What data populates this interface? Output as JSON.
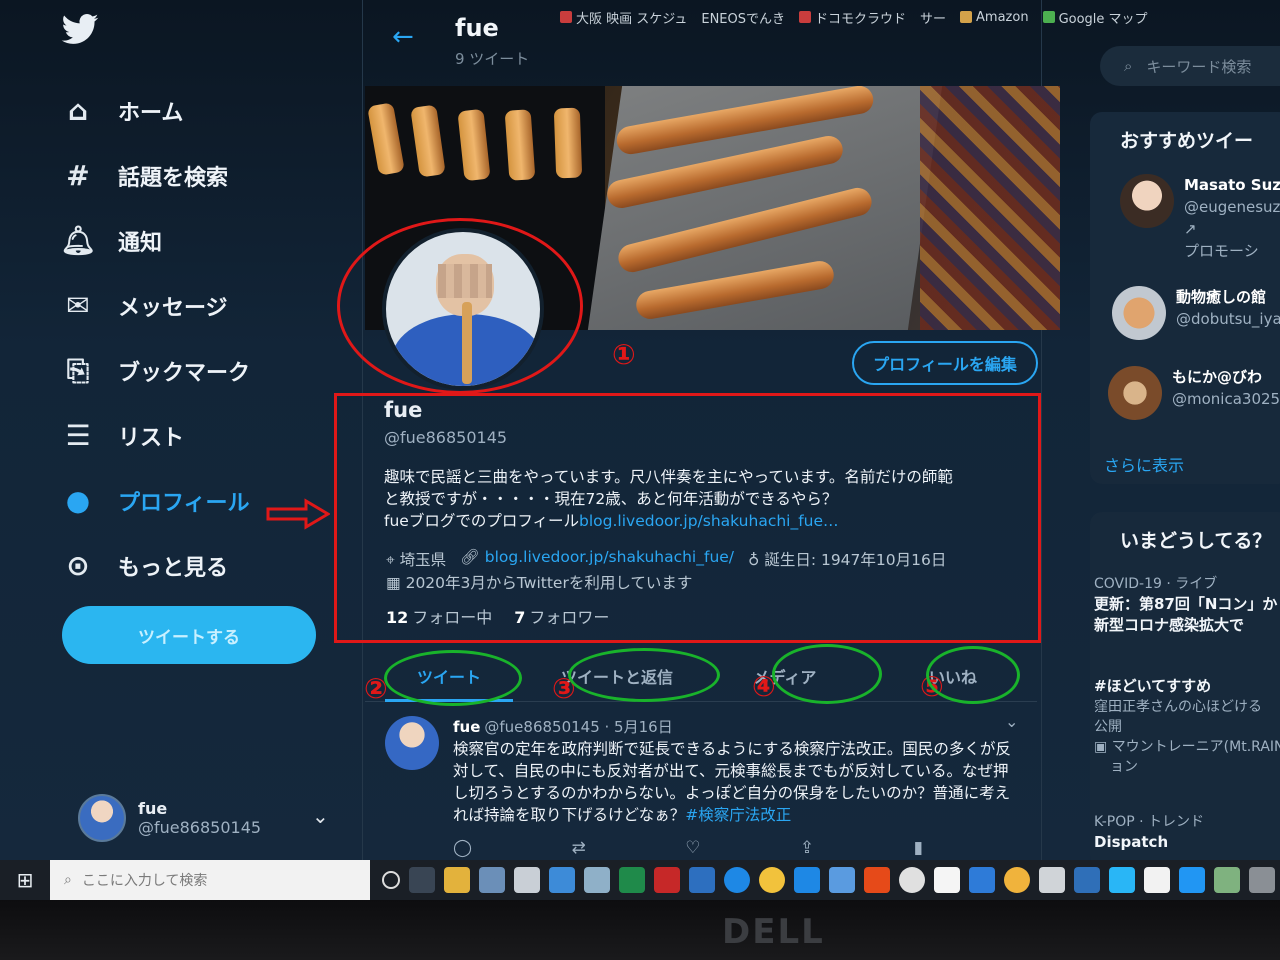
{
  "bookmarks": [
    "大阪 映画 スケジュ",
    "ENEOSでんき",
    "ドコモクラウド",
    "サー",
    "Amazon",
    "Google マップ"
  ],
  "header": {
    "title": "fue",
    "subtitle": "9 ツイート"
  },
  "sidebar": {
    "items": [
      {
        "label": "ホーム",
        "icon": "home-icon"
      },
      {
        "label": "話題を検索",
        "icon": "hashtag-icon"
      },
      {
        "label": "通知",
        "icon": "bell-icon"
      },
      {
        "label": "メッセージ",
        "icon": "mail-icon"
      },
      {
        "label": "ブックマーク",
        "icon": "bookmark-icon"
      },
      {
        "label": "リスト",
        "icon": "list-icon"
      },
      {
        "label": "プロフィール",
        "icon": "user-icon",
        "active": true
      },
      {
        "label": "もっと見る",
        "icon": "more-icon"
      }
    ],
    "tweet_button": "ツイートする",
    "account": {
      "name": "fue",
      "handle": "@fue86850145"
    }
  },
  "profile": {
    "edit_button": "プロフィールを編集",
    "name": "fue",
    "handle": "@fue86850145",
    "bio_line1": "趣味で民謡と三曲をやっています。尺八伴奏を主にやっています。名前だけの師範",
    "bio_line2": "と教授ですが・・・・・現在72歳、あと何年活動ができるやら？",
    "bio_line3_text": "fueブログでのプロフィール",
    "bio_line3_link": "blog.livedoor.jp/shakuhachi_fue…",
    "location": "埼玉県",
    "website": "blog.livedoor.jp/shakuhachi_fue/",
    "birthday": "誕生日: 1947年10月16日",
    "joined": "2020年3月からTwitterを利用しています",
    "following_count": "12",
    "following_label": "フォロー中",
    "followers_count": "7",
    "followers_label": "フォロワー"
  },
  "tabs": [
    "ツイート",
    "ツイートと返信",
    "メディア",
    "いいね"
  ],
  "tweet": {
    "name": "fue",
    "meta": "@fue86850145 · 5月16日",
    "body": "検察官の定年を政府判断で延長できるようにする検察庁法改正。国民の多くが反対して、自民の中にも反対者が出て、元検事総長までもが反対している。なぜ押し切ろうとするのかわからない。よっぽど自分の保身をしたいのか？普通に考えれば持論を取り下げるけどなぁ？",
    "hashtag": "#検察庁法改正"
  },
  "right": {
    "search_placeholder": "キーワード検索",
    "recommend_title": "おすすめツイー",
    "users": [
      {
        "name": "Masato Suzu",
        "handle": "@eugenesuz",
        "extra": "プロモーシ"
      },
      {
        "name": "動物癒しの館",
        "handle": "@dobutsu_iya"
      },
      {
        "name": "もにか@びわ",
        "handle": "@monica3025"
      }
    ],
    "show_more": "さらに表示",
    "trends_title": "いまどうしてる？",
    "trend1_cat": "COVID-19 · ライブ",
    "trend1_line1": "更新：第87回「Nコン」か",
    "trend1_line2": "新型コロナ感染拡大で",
    "trend2_tag": "#ほどいてすすめ",
    "trend2_line1": "窪田正孝さんの心ほどける",
    "trend2_line2": "公開",
    "trend2_promo": "マウントレーニア(Mt.RAINI",
    "trend2_promo2": "ョン",
    "trend3_cat": "K-POP · トレンド",
    "trend3_name": "Dispatch"
  },
  "annotations": {
    "numbers": [
      "①",
      "②",
      "③",
      "④",
      "⑤"
    ],
    "red": "#e01818",
    "green": "#19b32b"
  },
  "taskbar": {
    "search_placeholder": "ここに入力して検索"
  },
  "monitor_brand": "DELL",
  "colors": {
    "accent": "#2aa6f2",
    "background": "#15283c"
  }
}
